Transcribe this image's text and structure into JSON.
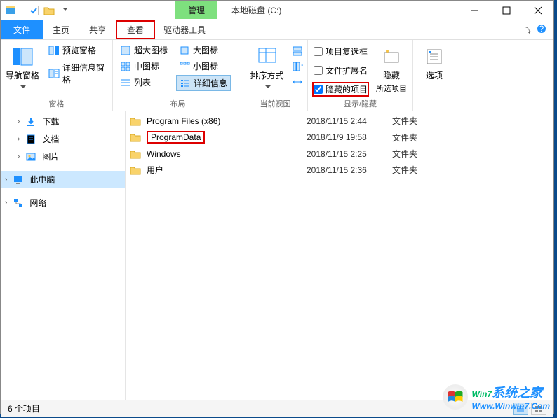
{
  "window": {
    "context_tab": "管理",
    "context_sub": "驱动器工具",
    "title": "本地磁盘 (C:)"
  },
  "menu": {
    "file": "文件",
    "home": "主页",
    "share": "共享",
    "view": "查看"
  },
  "ribbon": {
    "panes_group": "窗格",
    "layout_group": "布局",
    "currentview_group": "当前视图",
    "showhide_group": "显示/隐藏",
    "nav_pane": "导航窗格",
    "preview_pane": "预览窗格",
    "details_pane": "详细信息窗格",
    "extra_large": "超大图标",
    "large": "大图标",
    "medium": "中图标",
    "small": "小图标",
    "list": "列表",
    "details": "详细信息",
    "sort": "排序方式",
    "item_checkboxes": "项目复选框",
    "file_ext": "文件扩展名",
    "hidden_items": "隐藏的项目",
    "hide_selected": "隐藏",
    "hide_selected_sub": "所选项目",
    "options": "选项"
  },
  "nav": {
    "downloads": "下载",
    "documents": "文档",
    "pictures": "图片",
    "this_pc": "此电脑",
    "network": "网络"
  },
  "files": [
    {
      "name": "Program Files (x86)",
      "date": "2018/11/15 2:44",
      "type": "文件夹",
      "highlighted": false
    },
    {
      "name": "ProgramData",
      "date": "2018/11/9 19:58",
      "type": "文件夹",
      "highlighted": true
    },
    {
      "name": "Windows",
      "date": "2018/11/15 2:25",
      "type": "文件夹",
      "highlighted": false
    },
    {
      "name": "用户",
      "date": "2018/11/15 2:36",
      "type": "文件夹",
      "highlighted": false
    }
  ],
  "status": {
    "count": "6 个项目"
  },
  "watermark": {
    "brand_num": "Win7",
    "brand_text": "系统之家",
    "sub": "Www.Winwin7.Com"
  }
}
